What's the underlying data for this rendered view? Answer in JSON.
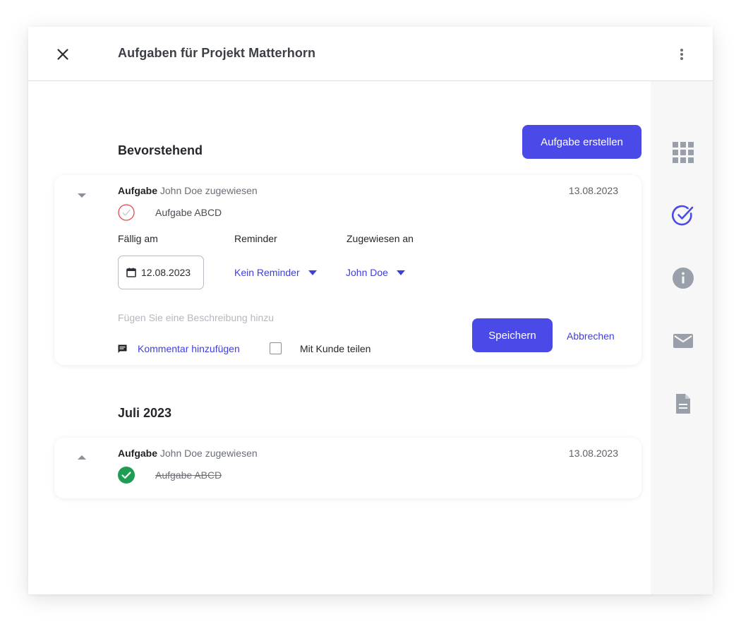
{
  "header": {
    "title": "Aufgaben für Projekt Matterhorn",
    "close_icon": "close-icon",
    "more_icon": "more-vertical-icon"
  },
  "colors": {
    "primary": "#4a4ae8",
    "link": "#3f3fd8",
    "success": "#1e9e54",
    "error": "#e5484d",
    "rail_icon": "#9aa0a9"
  },
  "sidebar_rail": {
    "items": [
      {
        "icon": "apps-grid-icon",
        "active": false
      },
      {
        "icon": "task-check-icon",
        "active": true
      },
      {
        "icon": "info-icon",
        "active": false
      },
      {
        "icon": "mail-icon",
        "active": false
      },
      {
        "icon": "document-icon",
        "active": false
      }
    ]
  },
  "upcoming": {
    "title": "Bevorstehend",
    "create_button": "Aufgabe erstellen",
    "task": {
      "type_label": "Aufgabe",
      "assigned_text": "John Doe zugewiesen",
      "date": "13.08.2023",
      "name": "Aufgabe ABCD",
      "completed": false,
      "expanded": true,
      "due_label": "Fällig am",
      "due_value": "12.08.2023",
      "reminder_label": "Reminder",
      "reminder_value": "Kein Reminder",
      "assignee_label": "Zugewiesen an",
      "assignee_value": "John Doe",
      "description_placeholder": "Fügen Sie eine Beschreibung hinzu",
      "comment_link": "Kommentar hinzufügen",
      "share_label": "Mit Kunde teilen",
      "share_checked": false,
      "save_button": "Speichern",
      "cancel_link": "Abbrechen"
    }
  },
  "july": {
    "title": "Juli 2023",
    "task": {
      "type_label": "Aufgabe",
      "assigned_text": "John Doe zugewiesen",
      "date": "13.08.2023",
      "name": "Aufgabe ABCD",
      "completed": true,
      "expanded": false
    }
  }
}
